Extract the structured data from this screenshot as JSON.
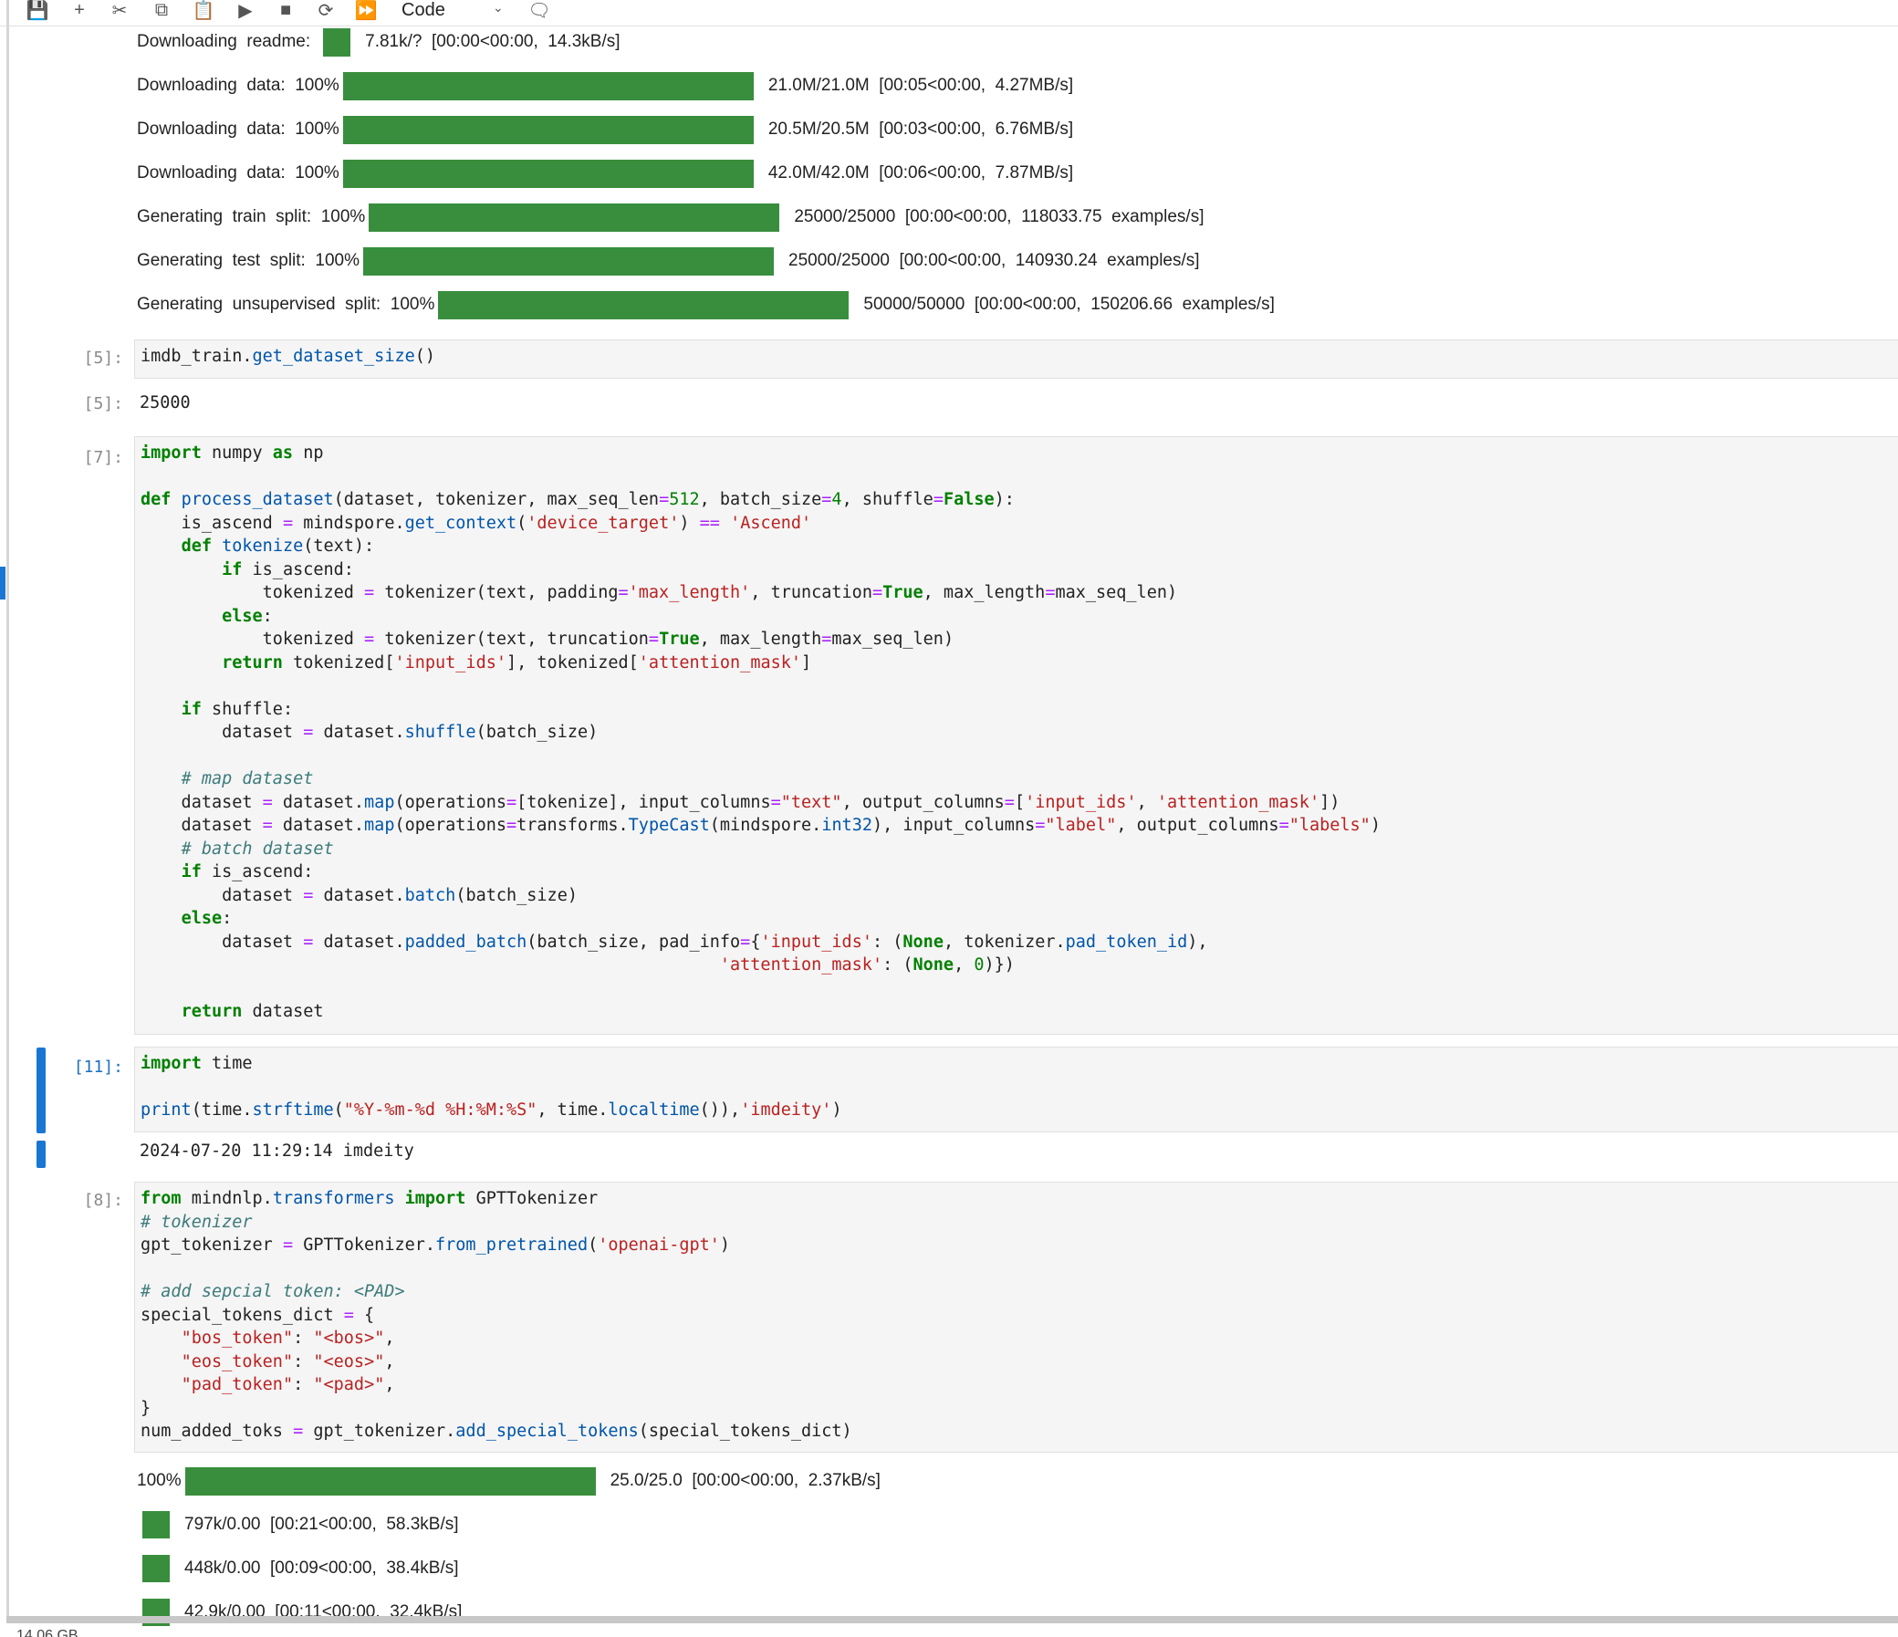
{
  "toolbar": {
    "cell_type": "Code"
  },
  "top_progress": [
    {
      "label": "Downloading  readme:",
      "pct": "",
      "stats": "7.81k/?  [00:00<00:00,  14.3kB/s]",
      "fill": 1.0
    },
    {
      "label": "Downloading  data:",
      "pct": "100%",
      "stats": "21.0M/21.0M  [00:05<00:00,  4.27MB/s]",
      "fill": 1.0
    },
    {
      "label": "Downloading  data:",
      "pct": "100%",
      "stats": "20.5M/20.5M  [00:03<00:00,  6.76MB/s]",
      "fill": 1.0
    },
    {
      "label": "Downloading  data:",
      "pct": "100%",
      "stats": "42.0M/42.0M  [00:06<00:00,  7.87MB/s]",
      "fill": 1.0
    },
    {
      "label": "Generating  train  split:",
      "pct": "100%",
      "stats": "25000/25000  [00:00<00:00,  118033.75  examples/s]",
      "fill": 1.0
    },
    {
      "label": "Generating  test  split:",
      "pct": "100%",
      "stats": "25000/25000  [00:00<00:00,  140930.24  examples/s]",
      "fill": 1.0
    },
    {
      "label": "Generating  unsupervised  split:",
      "pct": "100%",
      "stats": "50000/50000  [00:00<00:00,  150206.66  examples/s]",
      "fill": 1.0
    }
  ],
  "cells": {
    "c5": {
      "prompt": "[5]:",
      "out_prompt": "[5]:",
      "output": "25000"
    },
    "c7": {
      "prompt": "[7]:"
    },
    "c11": {
      "prompt": "[11]:",
      "output": "2024-07-20 11:29:14 imdeity"
    },
    "c8": {
      "prompt": "[8]:"
    }
  },
  "bottom_progress": [
    {
      "pct": "100%",
      "stats": "25.0/25.0  [00:00<00:00,  2.37kB/s]",
      "fill": 1.0
    },
    {
      "pct": "",
      "stats": "797k/0.00  [00:21<00:00,  58.3kB/s]",
      "fill": 1.0
    },
    {
      "pct": "",
      "stats": "448k/0.00  [00:09<00:00,  38.4kB/s]",
      "fill": 1.0
    },
    {
      "pct": "",
      "stats": "42.9k/0.00  [00:11<00:00,  32.4kB/s]",
      "fill": 1.0
    }
  ],
  "status_bar": "14.06 GB"
}
